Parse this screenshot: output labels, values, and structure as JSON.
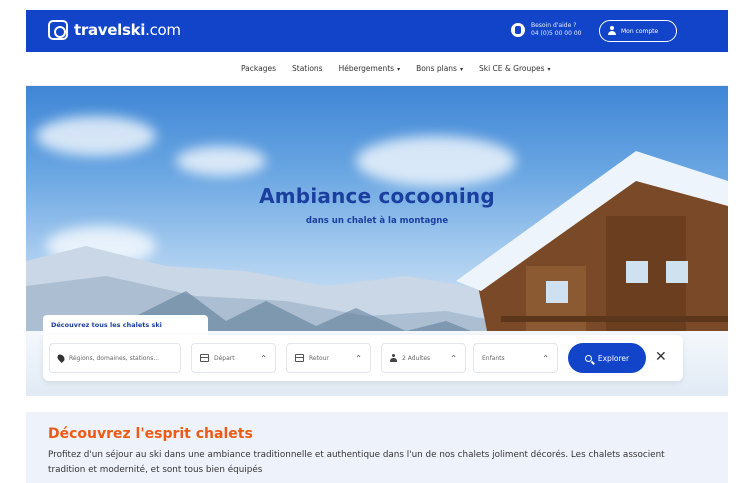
{
  "brand": {
    "name_main": "travelski",
    "name_domain": ".com"
  },
  "header": {
    "phone_line1": "Besoin d'aide ?",
    "phone_line2": "04 (0)5 00 00 00",
    "account_label": "Mon compte"
  },
  "nav": {
    "items": [
      {
        "label": "Packages",
        "has_caret": false
      },
      {
        "label": "Stations",
        "has_caret": false
      },
      {
        "label": "Hébergements",
        "has_caret": true
      },
      {
        "label": "Bons plans",
        "has_caret": true
      },
      {
        "label": "Ski CE & Groupes",
        "has_caret": true
      }
    ]
  },
  "hero": {
    "title": "Ambiance cocooning",
    "subtitle": "dans un chalet à la montagne"
  },
  "search": {
    "tab_label": "Découvrez tous les chalets ski",
    "destination_placeholder": "Régions, domaines, stations...",
    "depart_label": "Départ",
    "retour_label": "Retour",
    "adults_label": "2 Adultes",
    "enfants_label": "Enfants",
    "button_label": "Explorer",
    "clear_symbol": "✕"
  },
  "content": {
    "title": "Découvrez l'esprit chalets",
    "text": "Profitez d'un séjour au ski dans une ambiance traditionnelle et authentique dans l'un de nos chalets joliment décorés. Les chalets associent tradition et modernité, et sont tous bien équipés"
  }
}
